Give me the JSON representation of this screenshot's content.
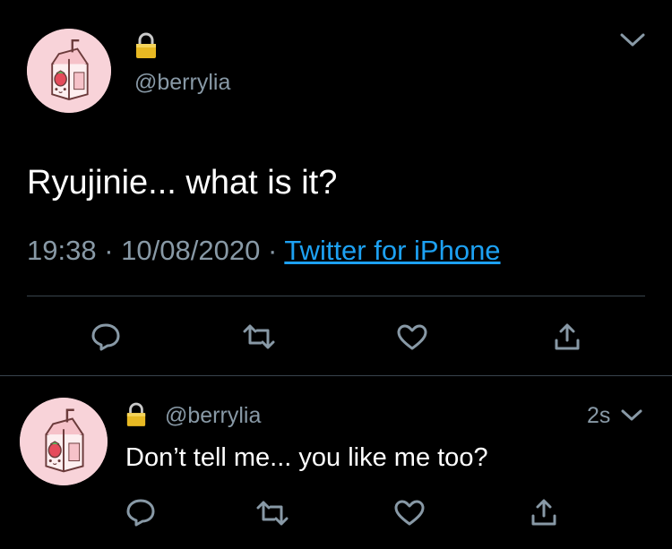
{
  "main_tweet": {
    "handle": "@berrylia",
    "text": "Ryujinie... what is it?",
    "time": "19:38",
    "separator": "·",
    "date": "10/08/2020",
    "source": "Twitter for iPhone",
    "avatar_icon": "strawberry-milk-carton-icon",
    "lock_icon": "lock-icon",
    "menu_icon": "chevron-down-icon"
  },
  "reply_tweet": {
    "handle": "@berrylia",
    "time_ago": "2s",
    "text": "Don’t tell me... you like me too?",
    "avatar_icon": "strawberry-milk-carton-icon",
    "lock_icon": "lock-icon",
    "menu_icon": "chevron-down-icon"
  },
  "actions": [
    "reply-icon",
    "retweet-icon",
    "like-icon",
    "share-icon"
  ],
  "colors": {
    "background": "#000000",
    "text": "#ffffff",
    "muted": "#8899a6",
    "link": "#1da1f2",
    "divider": "#38444d",
    "avatar_bg": "#f8d3d9"
  }
}
